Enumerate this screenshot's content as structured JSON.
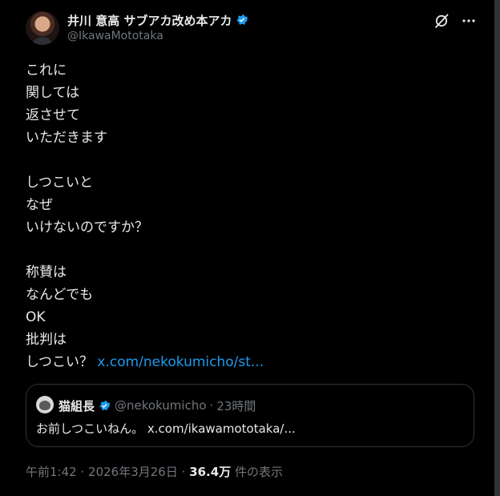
{
  "colors": {
    "background": "#000000",
    "text": "#e7e9ea",
    "secondary_text": "#71767b",
    "link": "#1d9bf0",
    "border": "#2f3336",
    "verified": "#1d9bf0"
  },
  "author": {
    "display_name": "井川 意高 サブアカ改め本アカ",
    "handle": "@IkawaMototaka",
    "verified": true,
    "avatar_icon": "author-avatar"
  },
  "header_icons": {
    "grok": "grok-icon",
    "more": "more-icon"
  },
  "tweet": {
    "lines": [
      "これに",
      "関しては",
      "返させて",
      "いただきます",
      "",
      "しつこいと",
      "なぜ",
      "いけないのですか？",
      "",
      "称賛は",
      "なんどでも",
      "OK",
      "批判は"
    ],
    "last_line_text": "しつこい？",
    "last_line_link": "x.com/nekokumicho/st..."
  },
  "quote": {
    "name": "猫組長",
    "handle": "@nekokumicho",
    "separator": "·",
    "time": "23時間",
    "text": "お前しつこいねん。",
    "link": "x.com/ikawamototaka/..."
  },
  "footer": {
    "time": "午前1:42",
    "sep1": "·",
    "date": "2026年3月26日",
    "sep2": "·",
    "views": "36.4万",
    "views_label": "件の表示"
  }
}
